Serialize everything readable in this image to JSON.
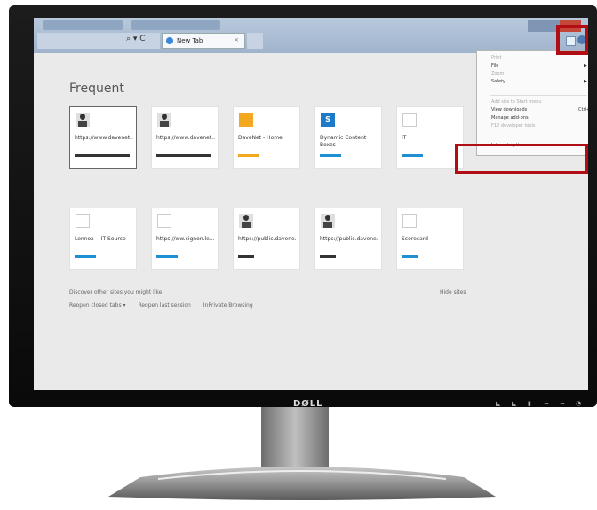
{
  "browser": {
    "tab_label": "New Tab",
    "tab_close": "×",
    "nav_controls": "⌕ ▾ C"
  },
  "new_tab_page": {
    "title": "Frequent",
    "tiles": [
      {
        "label": "https://www.davenet...",
        "icon": "person-avatar-icon",
        "bar_color": "#333333"
      },
      {
        "label": "https://www.davenet...",
        "icon": "person-avatar-icon",
        "bar_color": "#333333"
      },
      {
        "label": "DaveNet - Home",
        "icon": "davenet-logo-icon",
        "bar_color": "#f2a91f"
      },
      {
        "label": "Dynamic Content Boxes",
        "icon": "sharepoint-icon",
        "bar_color": "#1e8fd0"
      },
      {
        "label": "IT",
        "icon": "blank-page-icon",
        "bar_color": "#1e8fd0"
      },
      {
        "label": "Lennox -- IT Source",
        "icon": "blank-page-icon",
        "bar_color": "#1e8fd0"
      },
      {
        "label": "https://ww.signon.le...",
        "icon": "blank-page-icon",
        "bar_color": "#1e8fd0"
      },
      {
        "label": "https://public.davene...",
        "icon": "person-avatar-icon",
        "bar_color": "#333333"
      },
      {
        "label": "https://public.davene...",
        "icon": "person-avatar-icon",
        "bar_color": "#333333"
      },
      {
        "label": "Scorecard",
        "icon": "blank-page-icon",
        "bar_color": "#1e8fd0"
      }
    ],
    "discover_text": "Discover other sites you might like",
    "hide_sites": "Hide sites",
    "reopen_closed_tabs": "Reopen closed tabs ▾",
    "reopen_last_session": "Reopen last session",
    "inprivate": "InPrivate Browsing"
  },
  "tools_menu": {
    "items": [
      {
        "label": "Print",
        "disabled": true,
        "arrow": false,
        "shortcut": ""
      },
      {
        "label": "File",
        "disabled": false,
        "arrow": true,
        "shortcut": ""
      },
      {
        "label": "Zoom",
        "disabled": true,
        "arrow": false,
        "shortcut": ""
      },
      {
        "label": "Safety",
        "disabled": false,
        "arrow": true,
        "shortcut": ""
      },
      {
        "label": "Add site to Start menu",
        "disabled": true,
        "arrow": false,
        "shortcut": ""
      },
      {
        "label": "View downloads",
        "disabled": false,
        "arrow": false,
        "shortcut": "Ctrl+J"
      },
      {
        "label": "Manage add-ons",
        "disabled": false,
        "arrow": false,
        "shortcut": ""
      },
      {
        "label": "F12 developer tools",
        "disabled": true,
        "arrow": false,
        "shortcut": ""
      },
      {
        "label": "Internet options",
        "disabled": false,
        "arrow": false,
        "shortcut": ""
      }
    ]
  },
  "monitor": {
    "brand": "DØLL"
  },
  "highlight_color": "#b00d14"
}
